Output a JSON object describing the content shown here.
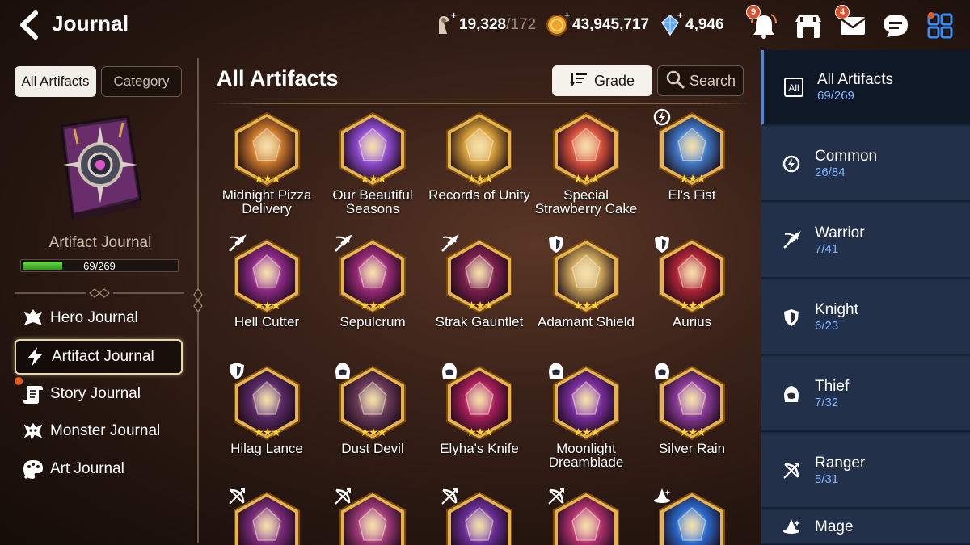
{
  "header": {
    "title": "Journal"
  },
  "resources": [
    {
      "icon": "stamina-icon",
      "value": "19,328",
      "sub": "/172"
    },
    {
      "icon": "gold-coin-icon",
      "value": "43,945,717",
      "sub": ""
    },
    {
      "icon": "crystal-icon",
      "value": "4,946",
      "sub": ""
    }
  ],
  "top_icons": [
    {
      "name": "notification-bell-icon",
      "badge": "9"
    },
    {
      "name": "shop-icon",
      "badge": ""
    },
    {
      "name": "mail-icon",
      "badge": "4"
    },
    {
      "name": "chat-icon",
      "badge": ""
    },
    {
      "name": "menu-grid-icon",
      "badge": ""
    }
  ],
  "left": {
    "tabs": {
      "all": "All Artifacts",
      "category": "Category"
    },
    "journal_label": "Artifact Journal",
    "progress": {
      "text": "69/269",
      "fraction": 0.256
    },
    "nav": [
      {
        "label": "Hero Journal",
        "icon": "hero-icon"
      },
      {
        "label": "Artifact Journal",
        "icon": "lightning-icon"
      },
      {
        "label": "Story Journal",
        "icon": "scroll-icon"
      },
      {
        "label": "Monster Journal",
        "icon": "monster-icon"
      },
      {
        "label": "Art Journal",
        "icon": "palette-icon"
      }
    ]
  },
  "main": {
    "title": "All Artifacts",
    "grade_label": "Grade",
    "search_label": "Search",
    "stars": "★★★",
    "artifacts": [
      {
        "name": "Midnight Pizza\nDelivery",
        "class": "",
        "color": "#c9772c"
      },
      {
        "name": "Our Beautiful\nSeasons",
        "class": "",
        "color": "#8f4bd1"
      },
      {
        "name": "Records of Unity",
        "class": "",
        "color": "#d49d38"
      },
      {
        "name": "Special\nStrawberry Cake",
        "class": "",
        "color": "#d8523e"
      },
      {
        "name": "El's Fist",
        "class": "common",
        "color": "#3f78c7"
      },
      {
        "name": "Hell Cutter",
        "class": "warrior",
        "color": "#8e2a8a"
      },
      {
        "name": "Sepulcrum",
        "class": "warrior",
        "color": "#9a2a7a"
      },
      {
        "name": "Strak Gauntlet",
        "class": "warrior",
        "color": "#7c2050"
      },
      {
        "name": "Adamant Shield",
        "class": "knight",
        "color": "#c9a35a"
      },
      {
        "name": "Aurius",
        "class": "knight",
        "color": "#b02436"
      },
      {
        "name": "Hilag Lance",
        "class": "knight",
        "color": "#5a2a68"
      },
      {
        "name": "Dust Devil",
        "class": "thief",
        "color": "#6a3a5a"
      },
      {
        "name": "Elyha's Knife",
        "class": "thief",
        "color": "#a81e5c"
      },
      {
        "name": "Moonlight\nDreamblade",
        "class": "thief",
        "color": "#7a2ea0"
      },
      {
        "name": "Silver Rain",
        "class": "thief",
        "color": "#8a3a9a"
      },
      {
        "name": "",
        "class": "ranger",
        "color": "#7b2c7c"
      },
      {
        "name": "",
        "class": "ranger",
        "color": "#a13a7a"
      },
      {
        "name": "",
        "class": "ranger",
        "color": "#6a2e9a"
      },
      {
        "name": "",
        "class": "ranger",
        "color": "#b03070"
      },
      {
        "name": "",
        "class": "mage",
        "color": "#2a6ad0"
      }
    ]
  },
  "right": {
    "categories": [
      {
        "label": "All Artifacts",
        "count": "69/269",
        "icon": "all-icon",
        "icon_text": "All"
      },
      {
        "label": "Common",
        "count": "26/84",
        "icon": "common-class-icon",
        "icon_text": ""
      },
      {
        "label": "Warrior",
        "count": "7/41",
        "icon": "warrior-class-icon",
        "icon_text": ""
      },
      {
        "label": "Knight",
        "count": "6/23",
        "icon": "knight-class-icon",
        "icon_text": ""
      },
      {
        "label": "Thief",
        "count": "7/32",
        "icon": "thief-class-icon",
        "icon_text": ""
      },
      {
        "label": "Ranger",
        "count": "5/31",
        "icon": "ranger-class-icon",
        "icon_text": ""
      },
      {
        "label": "Mage",
        "count": "",
        "icon": "mage-class-icon",
        "icon_text": ""
      }
    ]
  },
  "colors": {
    "accent_blue": "#7fb5ff",
    "progress_green": "#4fc13a",
    "star_gold": "#ffd23a",
    "badge_red": "#d9502c"
  }
}
